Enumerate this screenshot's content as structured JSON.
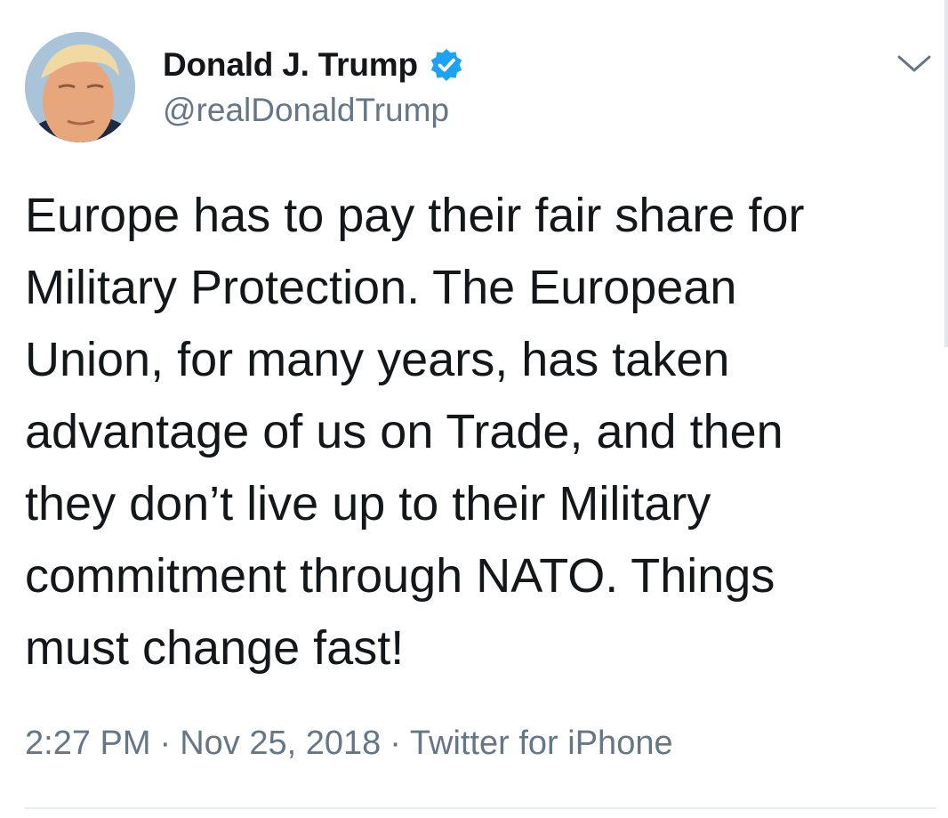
{
  "tweet": {
    "author": {
      "display_name": "Donald J. Trump",
      "handle": "@realDonaldTrump",
      "verified": true,
      "verified_icon": "verified-badge-icon",
      "verified_color": "#1da1f2"
    },
    "menu_icon": "chevron-down-icon",
    "text_lines": [
      "Europe has to pay their fair share for",
      "Military Protection. The European",
      "Union, for many years, has taken",
      "advantage of us on Trade, and then",
      "they don’t live up to their Military",
      "commitment through NATO. Things",
      "must change fast!"
    ],
    "meta": {
      "time": "2:27 PM",
      "separator": "·",
      "date": "Nov 25, 2018",
      "source": "Twitter for iPhone"
    }
  },
  "colors": {
    "text": "#14171a",
    "secondary_text": "#657786",
    "divider": "#e6ecf0"
  }
}
